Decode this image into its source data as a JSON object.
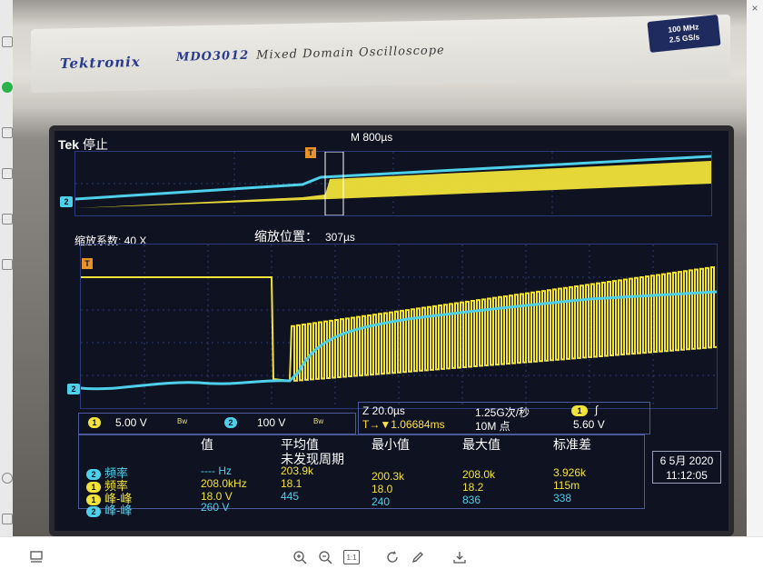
{
  "window": {
    "close_glyph": "×"
  },
  "instrument": {
    "brand": "Tektronix",
    "model": "MDO3012",
    "model_desc": "Mixed Domain Oscilloscope",
    "spec_line1": "100 MHz",
    "spec_line2": "2.5 GS/s"
  },
  "scope": {
    "title_brand": "Tek",
    "status": "停止",
    "timebase": "M 800µs",
    "zoom_factor": "缩放系数: 40 X",
    "zoom_position_label": "缩放位置：",
    "zoom_position_value": "307µs",
    "ch1_marker": "1",
    "ch2_marker": "2",
    "trigger_marker": "T",
    "ch1_scale": "5.00 V",
    "ch2_scale": "100 V",
    "bw_symbol": "Bw",
    "acq_zoom_time": "Z 20.0µs",
    "acq_sample_rate": "1.25G次/秒",
    "acq_trigger_pos": "T→▼1.06684ms",
    "acq_record_len": "10M 点",
    "trig_source": "1",
    "trig_slope": "∫",
    "trig_level": "5.60 V",
    "colors": {
      "ch1": "#f2e33a",
      "ch2": "#4fd0ea",
      "trigger": "#e8922a",
      "grid": "#2b3a7a"
    }
  },
  "measurements": {
    "headers": [
      "值",
      "平均值",
      "最小值",
      "最大值",
      "标准差"
    ],
    "subheader": "未发现周期",
    "rows": [
      {
        "ch": "2",
        "name": "频率",
        "value": "---- Hz",
        "mean": "",
        "min": "",
        "max": "",
        "std": ""
      },
      {
        "ch": "1",
        "name": "频率",
        "value": "208.0kHz",
        "mean": "203.9k",
        "min": "200.3k",
        "max": "208.0k",
        "std": "3.926k"
      },
      {
        "ch": "1",
        "name": "峰-峰",
        "value": "18.0 V",
        "mean": "18.1",
        "min": "18.0",
        "max": "18.2",
        "std": "115m"
      },
      {
        "ch": "2",
        "name": "峰-峰",
        "value": "260 V",
        "mean": "445",
        "min": "240",
        "max": "836",
        "std": "338"
      }
    ]
  },
  "datetime": {
    "date": "6 5月 2020",
    "time": "11:12:05"
  },
  "toolbar": {
    "layout_icon": "layout-icon",
    "zoom_in_icon": "zoom-in-icon",
    "zoom_out_icon": "zoom-out-icon",
    "actual_size_label": "1:1",
    "rotate_icon": "rotate-icon",
    "edit_icon": "edit-icon",
    "download_icon": "download-icon"
  }
}
